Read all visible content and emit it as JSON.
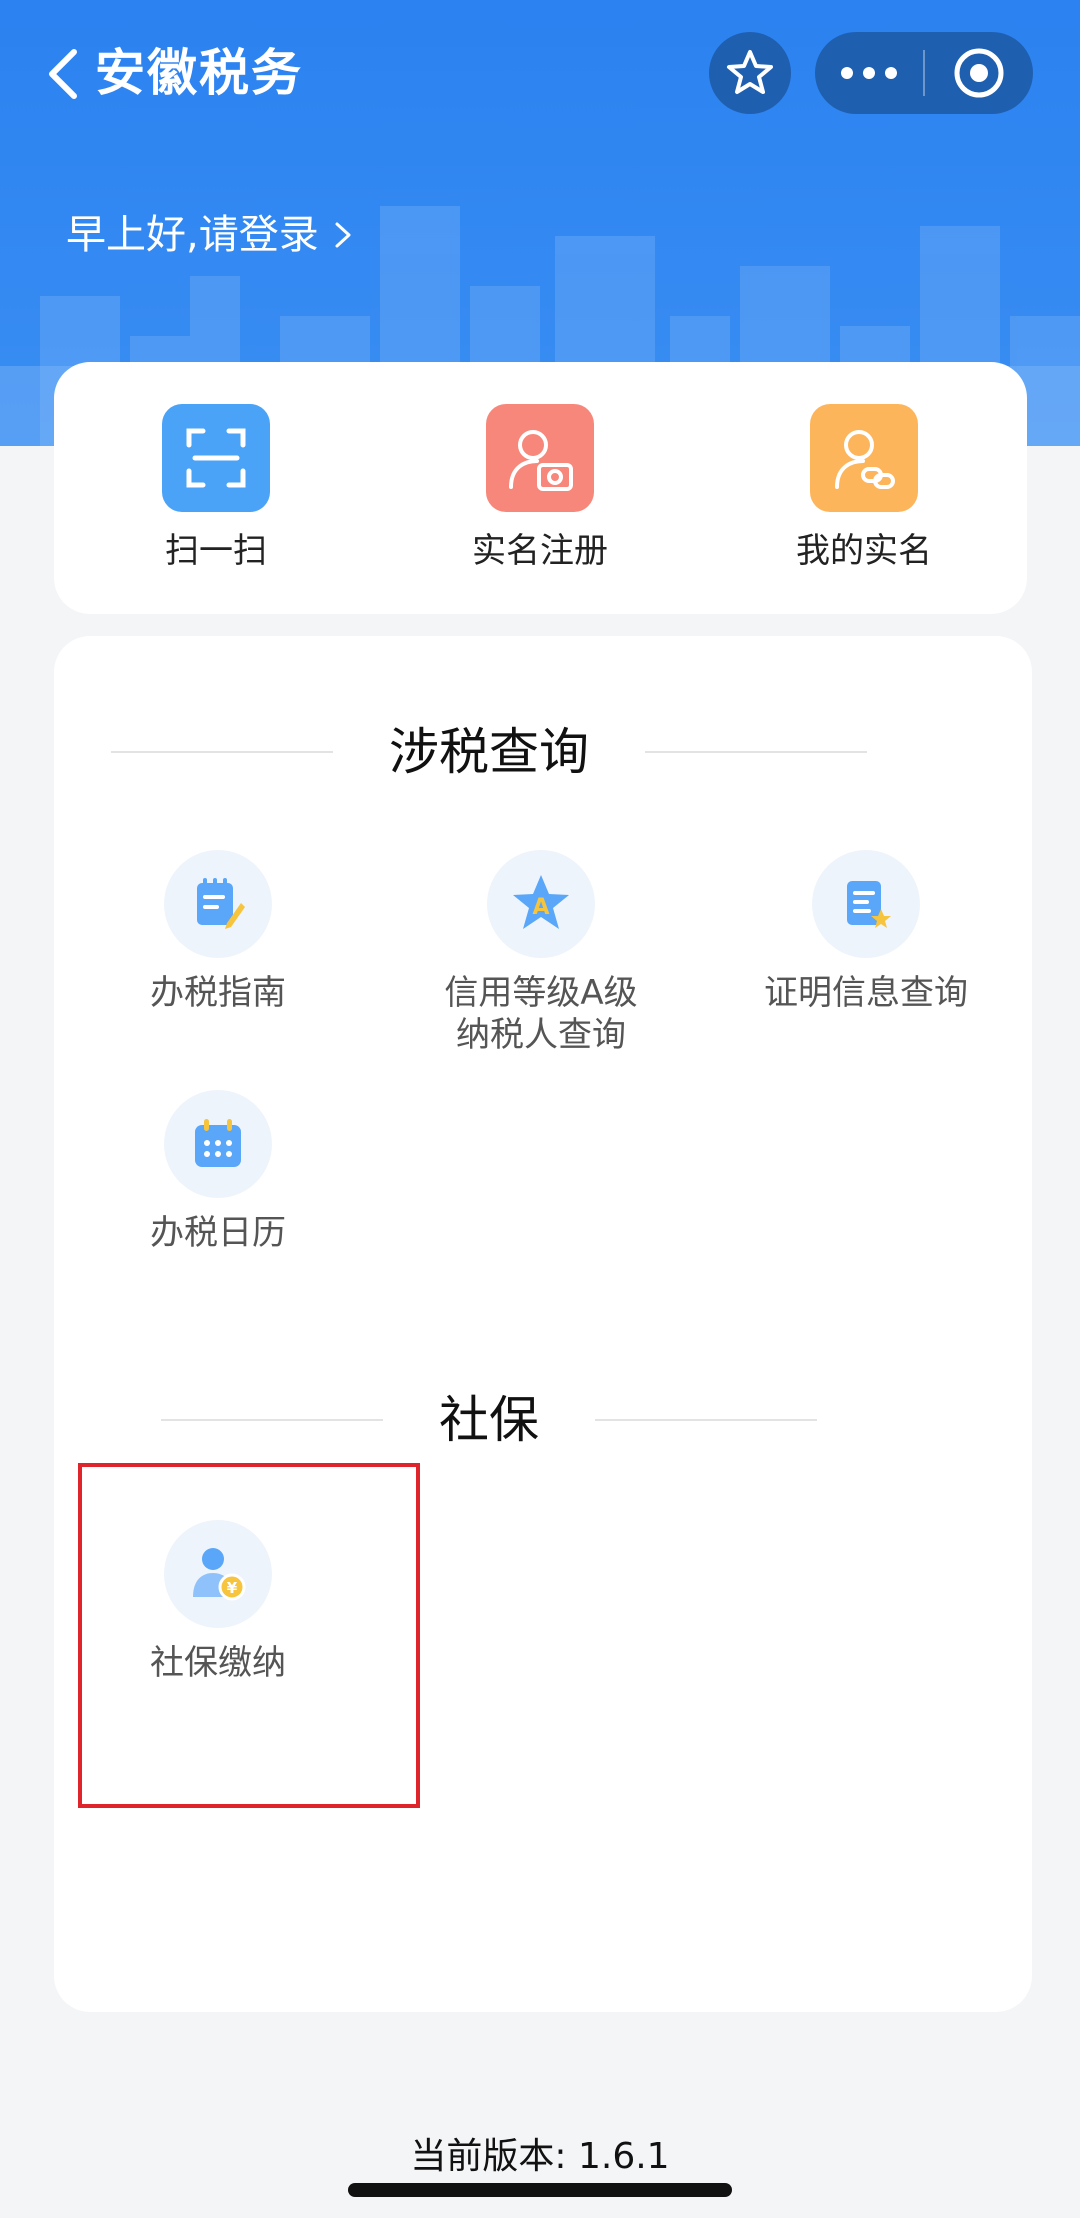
{
  "nav": {
    "title": "安徽税务",
    "back_icon": "chevron-left-icon",
    "favorite_icon": "star-outline-icon",
    "more_icon": "ellipsis-icon",
    "close_icon": "target-circle-icon"
  },
  "greeting": {
    "text": "早上好,请登录"
  },
  "quick_actions": [
    {
      "label": "扫一扫",
      "icon": "scan-icon",
      "color": "#4aa3f7"
    },
    {
      "label": "实名注册",
      "icon": "user-camera-icon",
      "color": "#f7877a"
    },
    {
      "label": "我的实名",
      "icon": "user-link-icon",
      "color": "#fdb55c"
    }
  ],
  "sections": [
    {
      "title": "涉税查询",
      "items": [
        {
          "label": "办税指南",
          "icon": "guide-notepad-icon"
        },
        {
          "label": "信用等级A级\n纳税人查询",
          "icon": "star-a-icon"
        },
        {
          "label": "证明信息查询",
          "icon": "certificate-icon"
        },
        {
          "label": "办税日历",
          "icon": "calendar-icon"
        }
      ]
    },
    {
      "title": "社保",
      "items": [
        {
          "label": "社保缴纳",
          "icon": "user-yuan-icon"
        }
      ]
    }
  ],
  "footer": {
    "version": "当前版本: 1.6.1"
  },
  "colors": {
    "header_blue": "#2b82f0",
    "capsule_dark": "#1f5fb0",
    "highlight_red": "#e0242b",
    "icon_blue": "#5aa6f8",
    "badge_yellow": "#f6c43d"
  }
}
